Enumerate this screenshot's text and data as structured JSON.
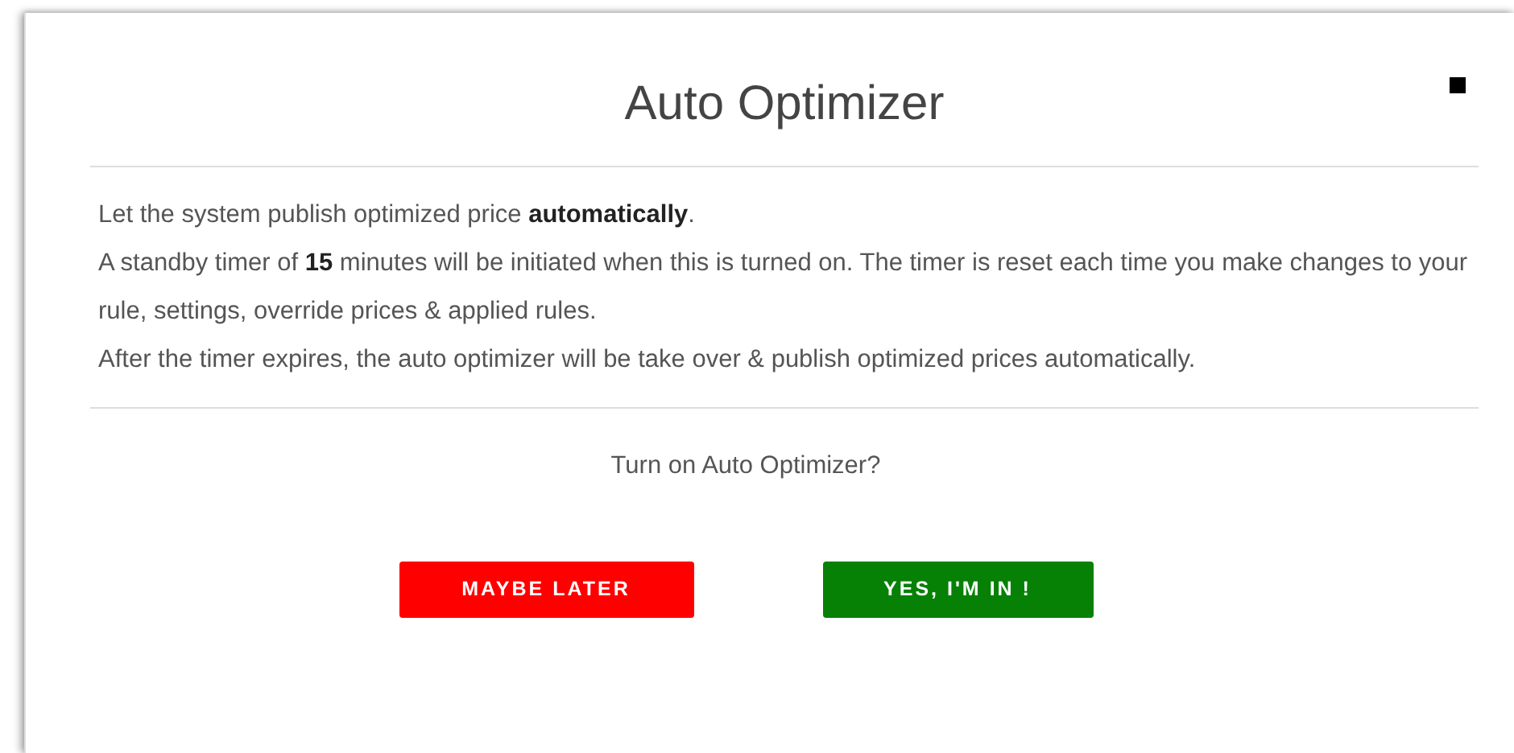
{
  "dialog": {
    "title": "Auto Optimizer",
    "paragraphs": [
      "Let the system publish optimized price **automatically**.",
      "A standby timer of **15** minutes will be initiated when this is turned on. The timer is reset each time you make changes to your rule, settings, override prices & applied rules.",
      "After the timer expires, the auto optimizer will be take over & publish optimized prices automatically."
    ],
    "question": "Turn on Auto Optimizer?",
    "buttons": [
      {
        "label": "MAYBE LATER",
        "kind": "decline"
      },
      {
        "label": "YES, I'M IN !",
        "kind": "accept"
      }
    ]
  }
}
